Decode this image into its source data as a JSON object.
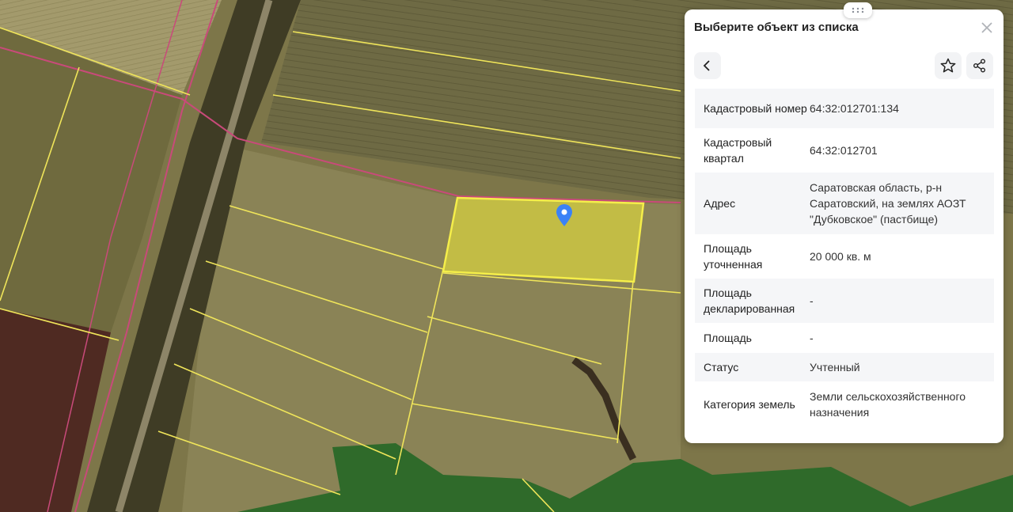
{
  "map": {
    "colors": {
      "field": "#7a7448",
      "field_dark": "#5c5634",
      "parcel_line": "#f0e55a",
      "road_line": "#c94a7a",
      "selected_fill": "#e8e23a",
      "forest": "#2f6a2a",
      "pin": "#3b82f6"
    }
  },
  "panel": {
    "title": "Выберите объект из списка",
    "icons": {
      "drag": "drag-handle-icon",
      "close": "close-icon",
      "back": "chevron-left-icon",
      "favorite": "star-icon",
      "share": "share-icon"
    },
    "rows": [
      {
        "key": "Кадастровый номер",
        "value": "64:32:012701:134"
      },
      {
        "key": "Кадастровый квартал",
        "value": "64:32:012701"
      },
      {
        "key": "Адрес",
        "value": "Саратовская область, р-н Саратовский, на землях АОЗТ \"Дубковское\" (пастбище)"
      },
      {
        "key": "Площадь уточненная",
        "value": "20 000 кв. м"
      },
      {
        "key": "Площадь декларированная",
        "value": "-"
      },
      {
        "key": "Площадь",
        "value": "-"
      },
      {
        "key": "Статус",
        "value": "Учтенный"
      },
      {
        "key": "Категория земель",
        "value": "Земли сельскохозяйственного назначения"
      }
    ]
  }
}
